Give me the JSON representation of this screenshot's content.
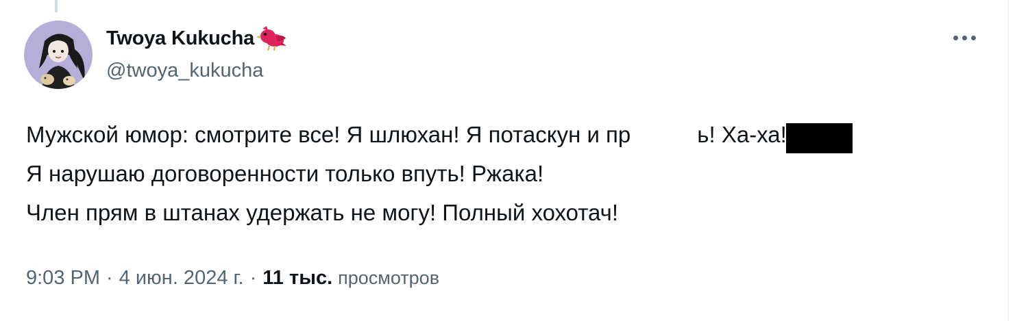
{
  "tweet": {
    "author": {
      "display_name": "Twoya Kukucha",
      "handle": "@twoya_kukucha",
      "name_emoji": "bird-emoji"
    },
    "text_lines": [
      "Мужской юмор: смотрите все! Я шлюхан! Я потаскун и пр",
      "ь! Ха-ха!",
      "Я нарушаю договоренности только впуть! Ржака!",
      "Член прям в штанах удержать не могу! Полный хохотач!"
    ],
    "time": "9:03 PM",
    "date": "4 июн. 2024 г.",
    "separator": "·",
    "views_count": "11 тыс.",
    "views_label": "просмотров",
    "more_icon": "more-horizontal-icon"
  },
  "colors": {
    "text_primary": "#0f1419",
    "text_secondary": "#536471",
    "bird": "#e0245e"
  }
}
